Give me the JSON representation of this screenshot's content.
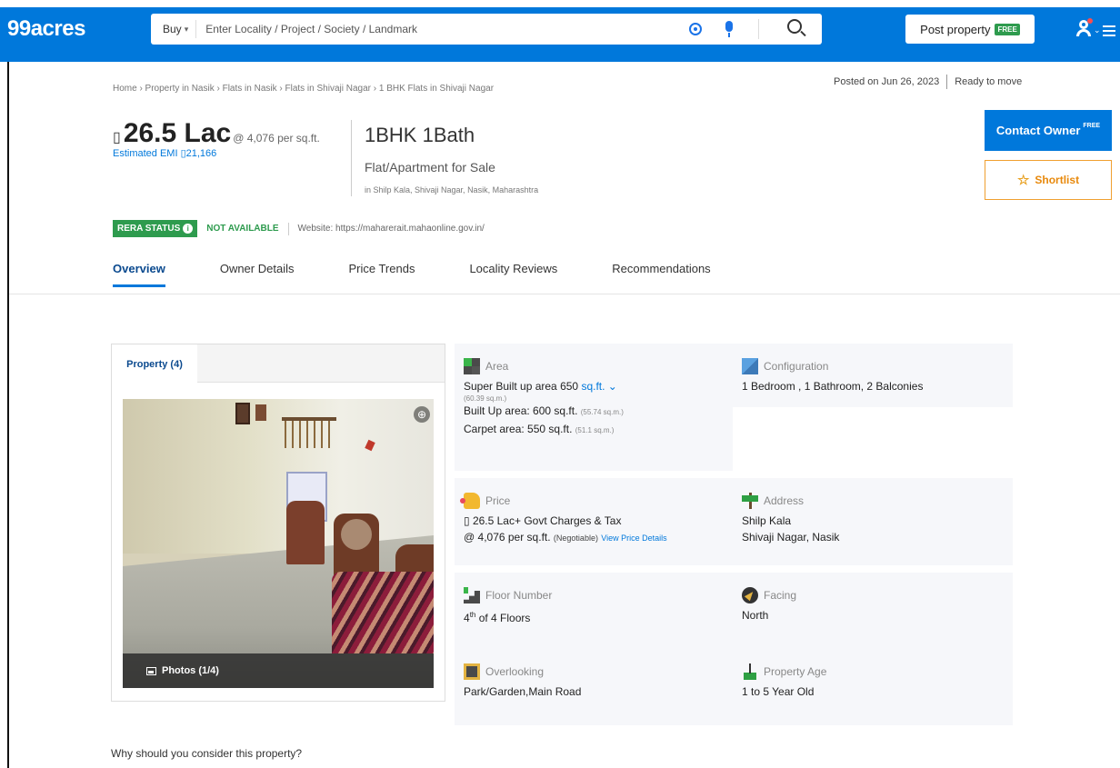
{
  "header": {
    "logo": "99acres",
    "buy_label": "Buy",
    "search_placeholder": "Enter Locality / Project / Society / Landmark",
    "post_property_label": "Post property",
    "post_property_tag": "FREE",
    "brand_color": "#0078db"
  },
  "breadcrumb": "Home › Property in Nasik › Flats in Nasik › Flats in Shivaji Nagar › 1 BHK Flats in Shivaji Nagar",
  "posted": {
    "date": "Posted on Jun 26, 2023",
    "status": "Ready to move"
  },
  "price": {
    "currency_glyph": "▯",
    "amount": "26.5 Lac",
    "per_sqft": "@ 4,076 per sq.ft.",
    "emi": "Estimated EMI ▯21,166"
  },
  "config": {
    "title": "1BHK 1Bath",
    "subtitle": "Flat/Apartment for Sale",
    "location": "in Shilp Kala, Shivaji Nagar, Nasik, Maharashtra"
  },
  "actions": {
    "contact_label": "Contact Owner",
    "contact_tag": "FREE",
    "shortlist_label": "Shortlist"
  },
  "rera": {
    "badge": "RERA STATUS",
    "status": "NOT AVAILABLE",
    "website": "Website: https://maharerait.mahaonline.gov.in/"
  },
  "tabs": [
    {
      "label": "Overview",
      "active": true
    },
    {
      "label": "Owner Details"
    },
    {
      "label": "Price Trends"
    },
    {
      "label": "Locality Reviews"
    },
    {
      "label": "Recommendations"
    }
  ],
  "photos": {
    "tab_label": "Property (4)",
    "caption": "Photos (1/4)"
  },
  "details": {
    "area": {
      "heading": "Area",
      "super_built": "Super Built up area 650",
      "unit": "sq.ft.",
      "super_built_sqm": "(60.39 sq.m.)",
      "built_up": "Built Up area: 600 sq.ft.",
      "built_up_sqm": "(55.74 sq.m.)",
      "carpet": "Carpet area: 550 sq.ft.",
      "carpet_sqm": "(51.1 sq.m.)"
    },
    "configuration": {
      "heading": "Configuration",
      "value": "1 Bedroom , 1 Bathroom, 2 Balconies"
    },
    "price": {
      "heading": "Price",
      "value": "▯ 26.5 Lac+ Govt Charges & Tax",
      "per_sqft": "@ 4,076 per sq.ft.",
      "negotiable": "(Negotiable)",
      "link": "View Price Details"
    },
    "address": {
      "heading": "Address",
      "line1": "Shilp Kala",
      "line2": "Shivaji Nagar, Nasik"
    },
    "floor": {
      "heading": "Floor Number",
      "floor": "4",
      "suffix": "th",
      "of": "of 4 Floors"
    },
    "facing": {
      "heading": "Facing",
      "value": "North"
    },
    "overlooking": {
      "heading": "Overlooking",
      "value": "Park/Garden,Main Road"
    },
    "age": {
      "heading": "Property Age",
      "value": "1 to 5 Year Old"
    }
  },
  "why_title": "Why should you consider this property?"
}
